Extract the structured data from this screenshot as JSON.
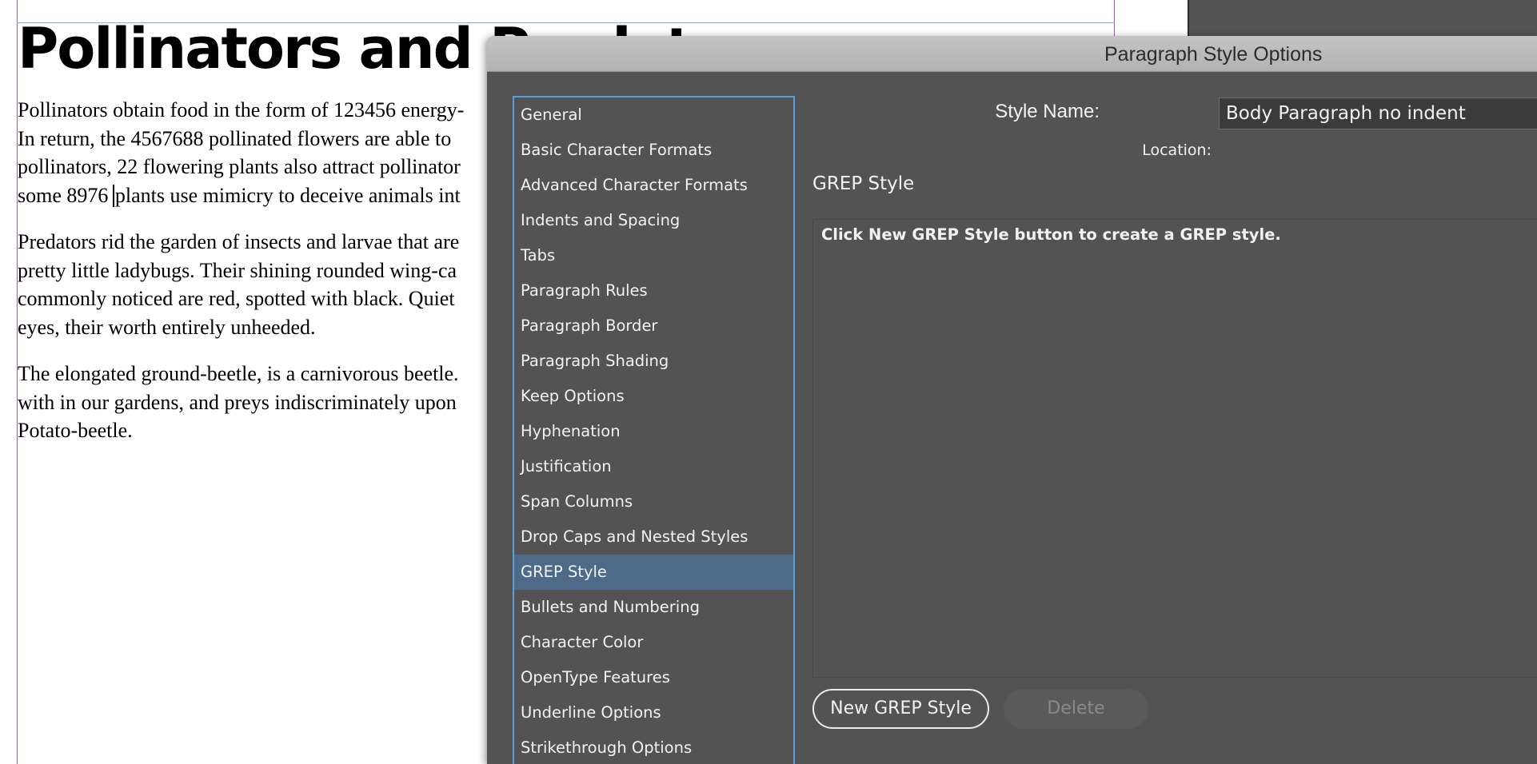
{
  "document": {
    "title": "Pollinators and Predators",
    "paragraphs": [
      {
        "lines": [
          "Pollinators obtain food in the form of 123456 energy-",
          "In return, the 4567688 pollinated flowers are able to",
          "pollinators, 22 flowering plants also attract pollinator"
        ],
        "cursor_line_before": "some 8976 ",
        "cursor_line_after": "plants use mimicry to deceive animals int"
      },
      {
        "lines": [
          "Predators rid the garden of insects and larvae that are",
          "pretty little ladybugs. Their shining rounded wing-ca",
          "commonly noticed are red, spotted with black. Quiet",
          "eyes, their worth entirely unheeded."
        ]
      },
      {
        "lines": [
          "The elongated ground-beetle, is a carnivorous beetle.",
          "with in our gardens, and preys indiscriminately upon",
          "Potato-beetle."
        ]
      }
    ]
  },
  "dialog": {
    "title": "Paragraph Style Options",
    "categories": [
      "General",
      "Basic Character Formats",
      "Advanced Character Formats",
      "Indents and Spacing",
      "Tabs",
      "Paragraph Rules",
      "Paragraph Border",
      "Paragraph Shading",
      "Keep Options",
      "Hyphenation",
      "Justification",
      "Span Columns",
      "Drop Caps and Nested Styles",
      "GREP Style",
      "Bullets and Numbering",
      "Character Color",
      "OpenType Features",
      "Underline Options",
      "Strikethrough Options"
    ],
    "selected_category": "GREP Style",
    "style_name_label": "Style Name:",
    "style_name_value": "Body Paragraph no indent",
    "location_label": "Location:",
    "section_title": "GREP Style",
    "grep_hint": "Click New GREP Style button to create a GREP style.",
    "new_button_label": "New GREP Style",
    "delete_button_label": "Delete"
  },
  "colors": {
    "dialog_bg": "#535353",
    "selection": "#4d6a89",
    "focus_ring": "#5b9dd9",
    "margin_guide": "#c04bd0",
    "frame_edge": "#7db3d8"
  }
}
